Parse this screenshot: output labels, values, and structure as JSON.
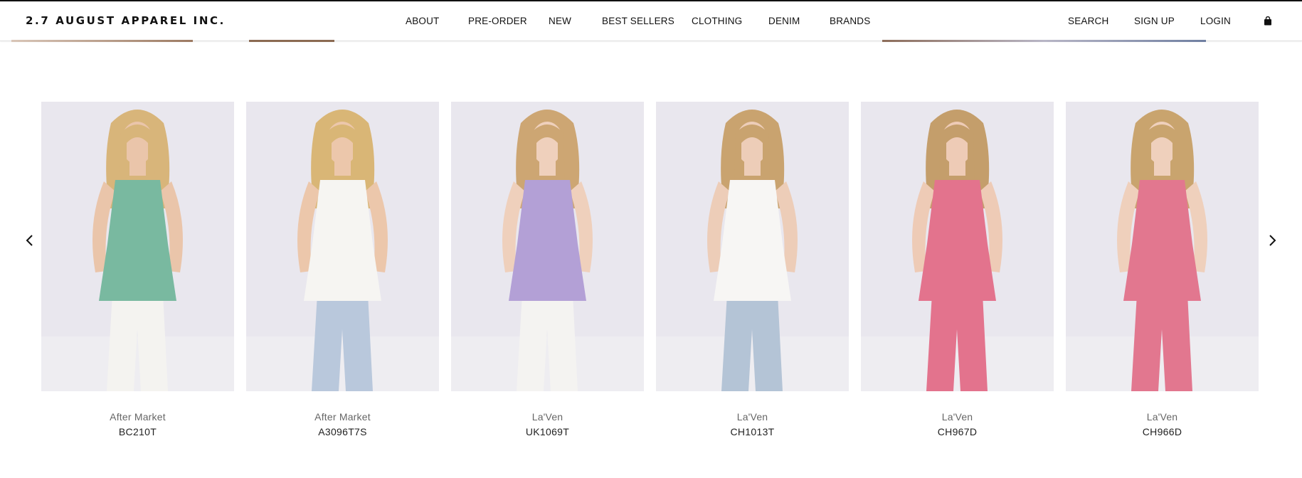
{
  "header": {
    "brand": "2.7 AUGUST APPAREL INC.",
    "nav": [
      {
        "label": "ABOUT"
      },
      {
        "label": "PRE-ORDER"
      },
      {
        "label": "NEW"
      },
      {
        "label": "BEST SELLERS"
      },
      {
        "label": "CLOTHING"
      },
      {
        "label": "DENIM"
      },
      {
        "label": "BRANDS"
      }
    ],
    "utility": [
      {
        "label": "SEARCH"
      },
      {
        "label": "SIGN UP"
      },
      {
        "label": "LOGIN"
      }
    ],
    "bag_icon": "shopping-bag-icon"
  },
  "carousel": {
    "prev_icon": "chevron-left-icon",
    "next_icon": "chevron-right-icon",
    "products": [
      {
        "brand": "After Market",
        "sku": "BC210T",
        "colors": {
          "top": "#79b9a0",
          "bottom": "#f4f3f0",
          "hair": "#d8b57a",
          "skin": "#eac5aa"
        }
      },
      {
        "brand": "After Market",
        "sku": "A3096T7S",
        "colors": {
          "top": "#f6f5f2",
          "bottom": "#b9c8dc",
          "hair": "#d9b676",
          "skin": "#ecc7ab"
        }
      },
      {
        "brand": "La'Ven",
        "sku": "UK1069T",
        "colors": {
          "top": "#b3a0d6",
          "bottom": "#f4f3f1",
          "hair": "#cda673",
          "skin": "#efd0bc"
        }
      },
      {
        "brand": "La'Ven",
        "sku": "CH1013T",
        "colors": {
          "top": "#f7f6f4",
          "bottom": "#b4c4d6",
          "hair": "#c9a36f",
          "skin": "#edcdb8"
        }
      },
      {
        "brand": "La'Ven",
        "sku": "CH967D",
        "colors": {
          "top": "#e3738d",
          "bottom": "#e3738d",
          "hair": "#c49e6b",
          "skin": "#eecbb6"
        }
      },
      {
        "brand": "La'Ven",
        "sku": "CH966D",
        "colors": {
          "top": "#e2778f",
          "bottom": "#e2778f",
          "hair": "#c9a46e",
          "skin": "#efd0bc"
        }
      }
    ]
  }
}
